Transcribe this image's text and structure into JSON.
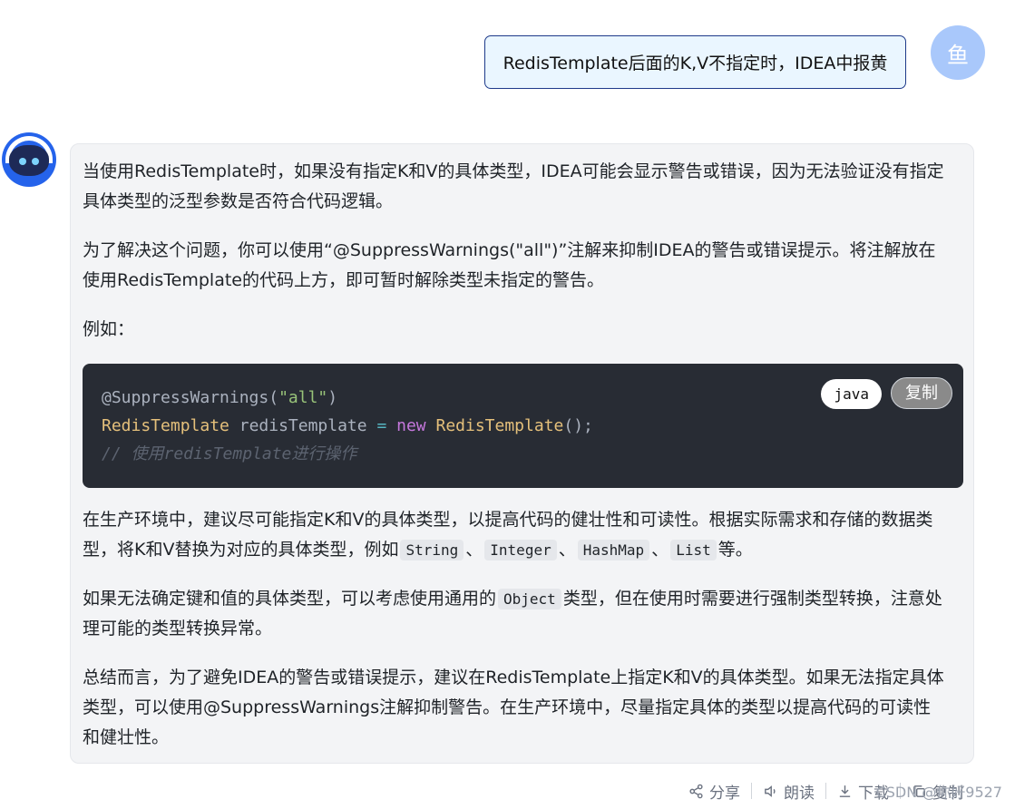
{
  "user": {
    "message": "RedisTemplate后面的K,V不指定时，IDEA中报黄",
    "avatar_text": "鱼"
  },
  "assistant": {
    "paragraphs": [
      "当使用RedisTemplate时，如果没有指定K和V的具体类型，IDEA可能会显示警告或错误，因为无法验证没有指定具体类型的泛型参数是否符合代码逻辑。",
      "为了解决这个问题，你可以使用“@SuppressWarnings(\"all\")”注解来抑制IDEA的警告或错误提示。将注解放在使用RedisTemplate的代码上方，即可暂时解除类型未指定的警告。",
      "例如："
    ],
    "code": {
      "language": "java",
      "copy_label": "复制",
      "line1": {
        "anno": "@SuppressWarnings(",
        "str": "\"all\"",
        "close": ")"
      },
      "line2": {
        "type": "RedisTemplate",
        "var": " redisTemplate ",
        "op": "=",
        "kw": " new ",
        "type2": "RedisTemplate",
        "rest": "();"
      },
      "line3": "// 使用redisTemplate进行操作"
    },
    "p4": {
      "text_before": "在生产环境中，建议尽可能指定K和V的具体类型，以提高代码的健壮性和可读性。根据实际需求和存储的数据类型，将K和V替换为对应的具体类型，例如",
      "codes": [
        "String",
        "Integer",
        "HashMap",
        "List"
      ],
      "sep": "、",
      "text_after": "等。"
    },
    "p5": {
      "text_before": "如果无法确定键和值的具体类型，可以考虑使用通用的",
      "code": "Object",
      "text_after": "类型，但在使用时需要进行强制类型转换，注意处理可能的类型转换异常。"
    },
    "p6": "总结而言，为了避免IDEA的警告或错误提示，建议在RedisTemplate上指定K和V的具体类型。如果无法指定具体类型，可以使用@SuppressWarnings注解抑制警告。在生产环境中，尽量指定具体的类型以提高代码的可读性和健壮性。"
  },
  "actions": {
    "share": "分享",
    "read": "朗读",
    "download": "下载",
    "copy": "复制"
  },
  "watermark": "CSDN @你好9527"
}
